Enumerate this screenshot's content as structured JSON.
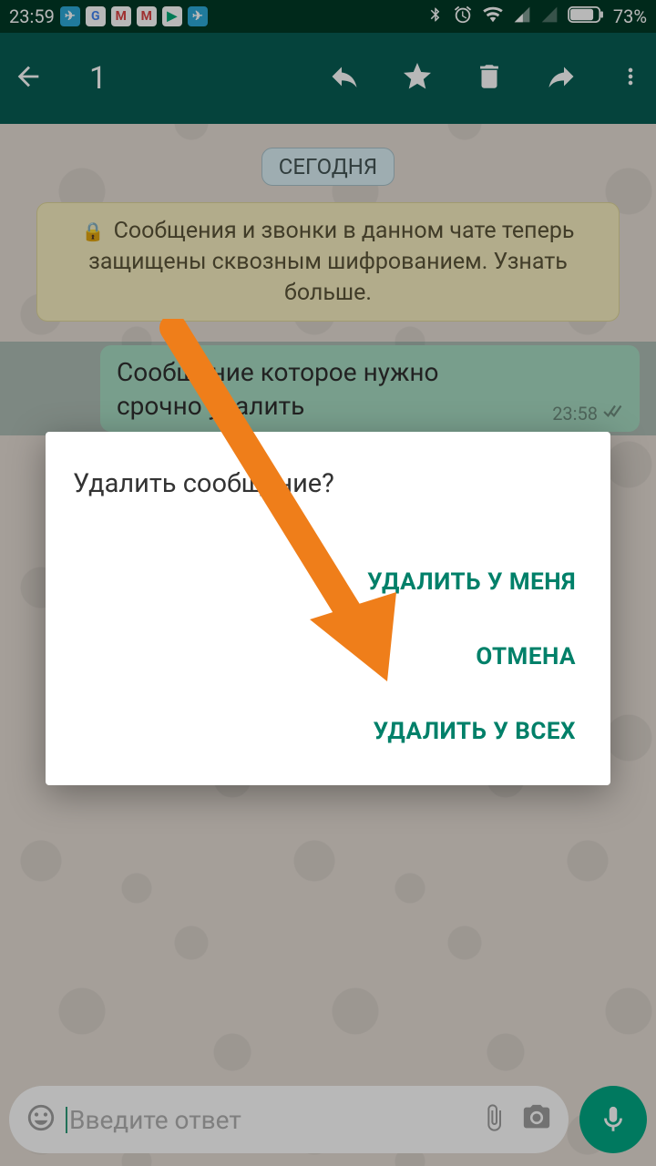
{
  "status": {
    "time": "23:59",
    "battery": "73%"
  },
  "appbar": {
    "selected_count": "1"
  },
  "chat": {
    "date_chip": "СЕГОДНЯ",
    "encryption_text": "Сообщения и звонки в данном чате теперь защищены сквозным шифрованием. Узнать больше.",
    "message_text": "Сообщение которое нужно срочно удалить",
    "message_time": "23:58"
  },
  "dialog": {
    "title": "Удалить сообщение?",
    "delete_for_me": "УДАЛИТЬ У МЕНЯ",
    "cancel": "ОТМЕНА",
    "delete_for_all": "УДАЛИТЬ У ВСЕХ"
  },
  "input": {
    "placeholder": "Введите ответ"
  },
  "colors": {
    "accent": "#075e54",
    "dialog_action": "#008069",
    "arrow": "#ef7e1a"
  }
}
